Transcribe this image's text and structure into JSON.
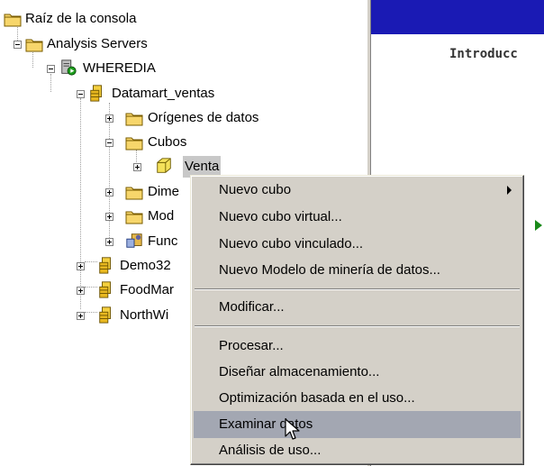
{
  "tree": {
    "root": "Raíz de la consola",
    "analysis_servers": "Analysis Servers",
    "server": "WHEREDIA",
    "db1": "Datamart_ventas",
    "data_sources": "Orígenes de datos",
    "cubes": "Cubos",
    "cube_venta": "Venta",
    "dimensions": "Dime",
    "models": "Mod",
    "functions": "Func",
    "db2": "Demo32",
    "db3": "FoodMar",
    "db4": "NorthWi"
  },
  "right_pane": {
    "title": "Introducc",
    "header_color": "#1a1ab4"
  },
  "context_menu": {
    "items": [
      {
        "label": "Nuevo cubo",
        "submenu": true
      },
      {
        "label": "Nuevo cubo virtual..."
      },
      {
        "label": "Nuevo cubo vinculado..."
      },
      {
        "label": "Nuevo Modelo de minería de datos..."
      },
      {
        "label": "Modificar..."
      },
      {
        "label": "Procesar..."
      },
      {
        "label": "Diseñar almacenamiento..."
      },
      {
        "label": "Optimización basada en el uso..."
      },
      {
        "label": "Examinar datos",
        "highlighted": true
      },
      {
        "label": "Análisis de uso..."
      }
    ],
    "highlight_color": "#a3a7b2"
  }
}
